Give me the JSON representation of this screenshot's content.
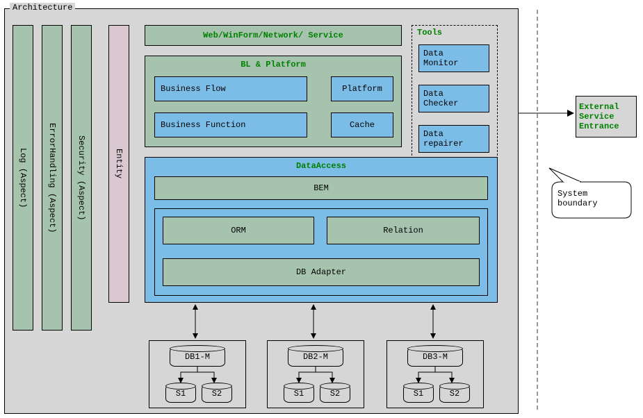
{
  "architecture": {
    "title": "Architecture"
  },
  "aspects": {
    "log": "Log (Aspect) ",
    "error": "ErrorHandling (Aspect) ",
    "security": "Security (Aspect) "
  },
  "entity": {
    "label": "Entity"
  },
  "top_layer": {
    "label": "Web/WinForm/Network/ Service"
  },
  "bl": {
    "title": "BL & Platform",
    "flow": "Business Flow",
    "platform": "Platform",
    "func": "Business Function",
    "cache": "Cache"
  },
  "tools": {
    "title": "Tools",
    "monitor": "Data\nMonitor",
    "checker": "Data\nChecker",
    "repairer": "Data\nrepairer"
  },
  "da": {
    "title": "DataAccess",
    "bem": "BEM",
    "orm": "ORM",
    "relation": "Relation",
    "adapter": "DB Adapter"
  },
  "dbs": [
    {
      "m": "DB1-M",
      "s1": "S1",
      "s2": "S2"
    },
    {
      "m": "DB2-M",
      "s1": "S1",
      "s2": "S2"
    },
    {
      "m": "DB3-M",
      "s1": "S1",
      "s2": "S2"
    }
  ],
  "external": {
    "label": "External\nService\nEntrance"
  },
  "boundary": {
    "label": "System\nboundary"
  }
}
